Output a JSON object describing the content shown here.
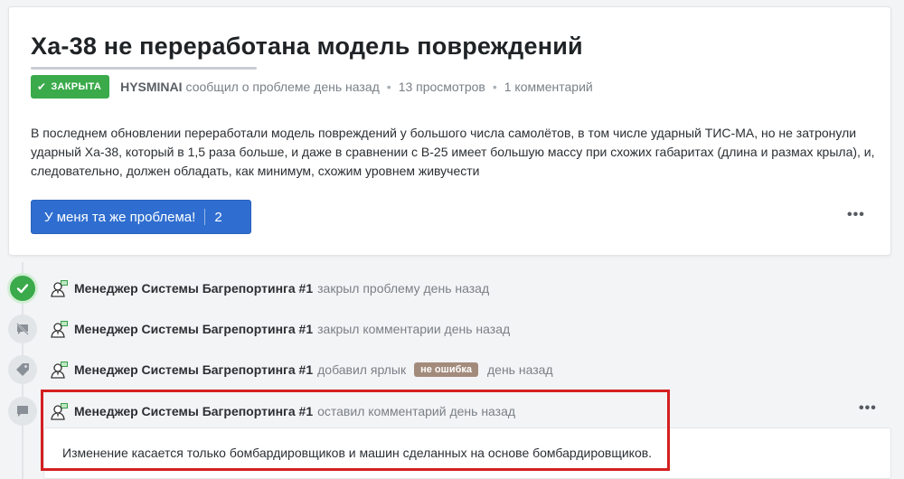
{
  "issue": {
    "title": "Ха-38 не переработана модель повреждений",
    "status_label": "ЗАКРЫТА",
    "author": "HYSMINAI",
    "reported_text": "сообщил о проблеме день назад",
    "views": "13 просмотров",
    "comments": "1 комментарий",
    "body": "В последнем обновлении переработали модель повреждений у большого числа самолётов, в том числе ударный ТИС-МА, но не затронули ударный Ха-38, который в 1,5 раза больше, и даже в сравнении с В-25 имеет большую массу при схожих габаритах (длина и размах крыла), и, следовательно, должен обладать, как минимум, схожим уровнем живучести",
    "same_problem_label": "У меня та же проблема!",
    "same_problem_count": "2",
    "more": "•••"
  },
  "timeline": {
    "events": [
      {
        "who": "Менеджер Системы Багрепортинга #1",
        "text": "закрыл проблему день назад"
      },
      {
        "who": "Менеджер Системы Багрепортинга #1",
        "text": "закрыл комментарии день назад"
      },
      {
        "who": "Менеджер Системы Багрепортинга #1",
        "text": "добавил ярлык",
        "tag": "не ошибка",
        "after": "день назад"
      },
      {
        "who": "Менеджер Системы Багрепортинга #1",
        "text": "оставил комментарий день назад"
      }
    ],
    "comment_body": "Изменение касается только бомбардировщиков и машин сделанных на основе бомбардировщиков.",
    "more": "•••"
  },
  "colors": {
    "accent": "#2f6ed0",
    "closed": "#3aaa4a",
    "tag": "#a38b7c",
    "highlight": "#d42020"
  }
}
